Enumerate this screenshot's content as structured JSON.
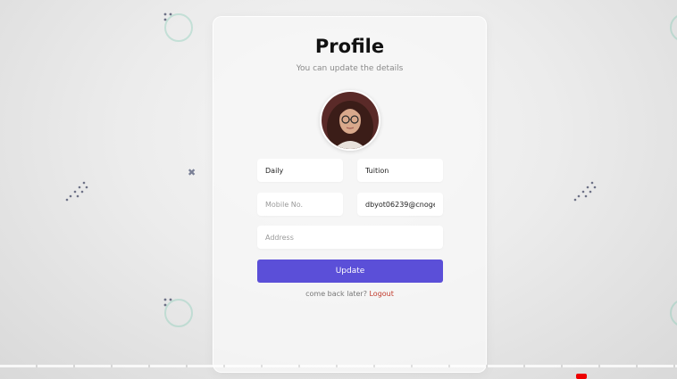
{
  "profile": {
    "title": "Profile",
    "subtitle": "You can update the details",
    "avatar_icon": "profile-photo"
  },
  "form": {
    "first_name": {
      "value": "Daily",
      "placeholder": ""
    },
    "last_name": {
      "value": "Tuition",
      "placeholder": ""
    },
    "mobile": {
      "value": "",
      "placeholder": "Mobile No."
    },
    "email": {
      "value": "dbyot06239@cnoge",
      "placeholder": ""
    },
    "address": {
      "value": "",
      "placeholder": "Address"
    }
  },
  "actions": {
    "update_label": "Update",
    "footer_text": "come back later?",
    "logout_label": "Logout"
  },
  "colors": {
    "accent": "#5b4fd8",
    "link": "#c0392b",
    "background": "#ececec"
  }
}
